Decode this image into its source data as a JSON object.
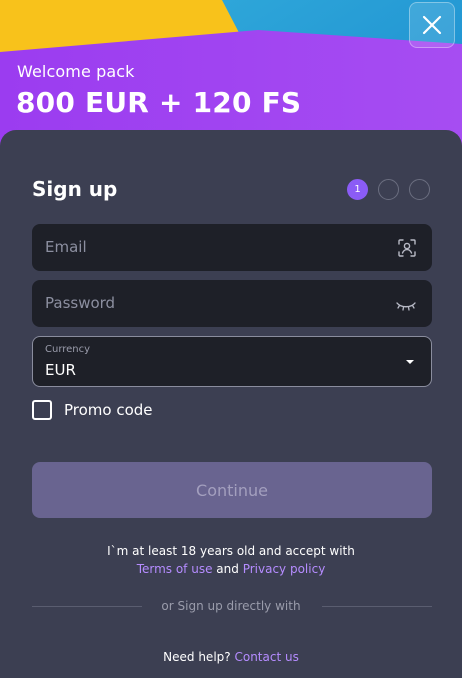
{
  "banner": {
    "label": "Welcome pack",
    "amount": "800 EUR + 120 FS"
  },
  "close_icon": "close-icon",
  "form": {
    "title": "Sign up",
    "steps": [
      "1",
      "",
      ""
    ],
    "email_placeholder": "Email",
    "password_placeholder": "Password",
    "currency_label": "Currency",
    "currency_value": "EUR",
    "promo_label": "Promo code",
    "continue_label": "Continue"
  },
  "legal": {
    "line1": "I`m at least 18 years old and accept with",
    "terms_label": "Terms of use",
    "and": "and",
    "privacy_label": "Privacy policy"
  },
  "social": {
    "divider_text": "or Sign up directly with"
  },
  "help": {
    "text": "Need help?",
    "contact_label": "Contact us"
  },
  "colors": {
    "accent": "#8b5cf6",
    "link": "#b58cff",
    "card_bg": "#3c3f52",
    "input_bg": "#1e2028",
    "button_disabled": "#696490"
  }
}
